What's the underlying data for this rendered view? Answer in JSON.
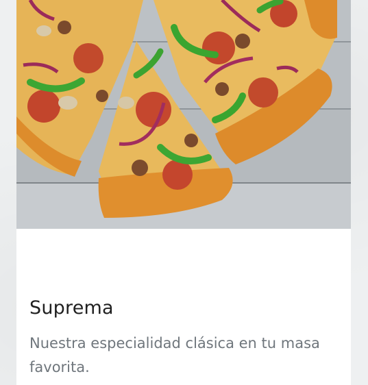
{
  "product": {
    "image_icon": "pizza-image",
    "name": "Suprema",
    "description": "Nuestra especialidad clásica en tu masa favorita."
  }
}
